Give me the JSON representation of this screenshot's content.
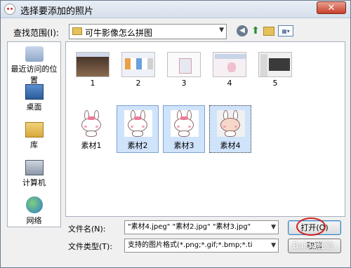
{
  "window": {
    "title": "选择要添加的照片",
    "close_glyph": "✕"
  },
  "toolbar": {
    "look_in_label": "查找范围(I):",
    "look_in_value": "可牛影像怎么拼图",
    "icons": [
      "back-icon",
      "up-folder-icon",
      "new-folder-icon",
      "views-menu-icon"
    ]
  },
  "places": [
    {
      "label": "最近访问的位置",
      "icon": "recent-places-icon"
    },
    {
      "label": "桌面",
      "icon": "desktop-icon"
    },
    {
      "label": "库",
      "icon": "library-icon"
    },
    {
      "label": "计算机",
      "icon": "computer-icon"
    },
    {
      "label": "网络",
      "icon": "network-icon"
    }
  ],
  "files": {
    "row1": [
      "1",
      "2",
      "3",
      "4",
      "5"
    ],
    "row2": [
      "素材1",
      "素材2",
      "素材3",
      "素材4"
    ]
  },
  "bottom": {
    "filename_label": "文件名(N):",
    "filename_value": "\"素材4.jpeg\" \"素材2.jpg\" \"素材3.jpg\"",
    "filetype_label": "文件类型(T):",
    "filetype_value": "支持的图片格式(*.png;*.gif;*.bmp;*.ti",
    "open_button": "打开(O)",
    "cancel_button": "取消"
  },
  "watermark": "Baidu经验",
  "colors": {
    "selection": "#cfe3fb",
    "highlight_circle": "#d02020"
  }
}
